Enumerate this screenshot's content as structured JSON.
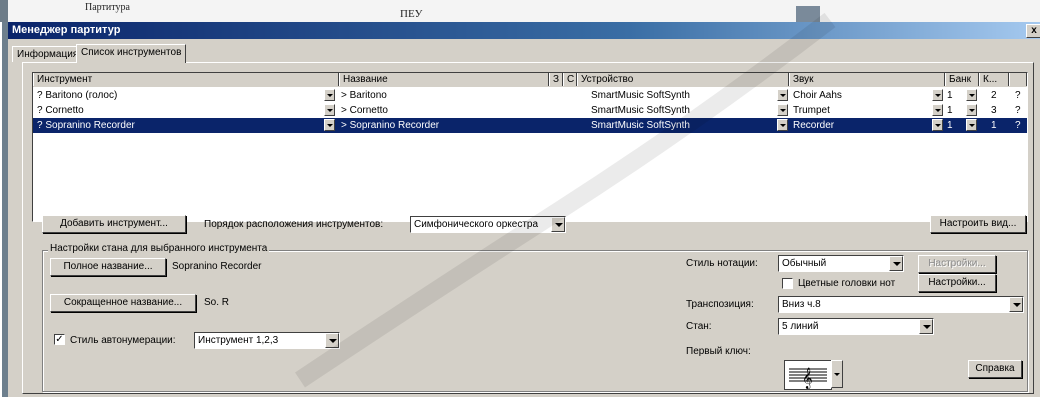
{
  "background": {
    "top_text_1": "Партитура",
    "top_text_2": "ПЕУ"
  },
  "window": {
    "title": "Менеджер партитур",
    "close_label": "x",
    "tabs": [
      {
        "label": "Информация"
      },
      {
        "label": "Список инструментов"
      }
    ]
  },
  "instruments_table": {
    "headers": [
      "Инструмент",
      "Название",
      "З",
      "С",
      "Устройство",
      "Звук",
      "Банк",
      "К..."
    ],
    "rows": [
      {
        "instrument": "? Baritono (голос)",
        "name": "> Baritono",
        "device": "SmartMusic SoftSynth",
        "sound": "Choir Aahs",
        "bank": "1",
        "k": "2",
        "q": "?"
      },
      {
        "instrument": "? Cornetto",
        "name": "> Cornetto",
        "device": "SmartMusic SoftSynth",
        "sound": "Trumpet",
        "bank": "1",
        "k": "3",
        "q": "?"
      },
      {
        "instrument": "? Sopranino Recorder",
        "name": "> Sopranino Recorder",
        "device": "SmartMusic SoftSynth",
        "sound": "Recorder",
        "bank": "1",
        "k": "1",
        "q": "?"
      }
    ]
  },
  "controls": {
    "add_instrument": "Добавить инструмент...",
    "order_label": "Порядок расположения инструментов:",
    "order_value": "Симфонического оркестра",
    "customize_view": "Настроить вид..."
  },
  "staff_settings": {
    "group_title": "Настройки стана для выбранного инструмента",
    "full_name_button": "Полное название...",
    "full_name_value": "Sopranino Recorder",
    "short_name_button": "Сокращенное название...",
    "short_name_value": "So. R",
    "autonumber_checkbox_mark": "✓",
    "autonumber_label": "Стиль автонумерации:",
    "autonumber_value": "Инструмент 1,2,3",
    "notation_style_label": "Стиль нотации:",
    "notation_style_value": "Обычный",
    "notation_settings_button": "Настройки...",
    "color_noteheads_label": "Цветные головки нот",
    "noteheads_settings_button": "Настройки...",
    "transposition_label": "Транспозиция:",
    "transposition_value": "Вниз ч.8",
    "staff_label": "Стан:",
    "staff_value": "5 линий",
    "first_clef_label": "Первый ключ:",
    "help_button": "Справка"
  },
  "colors": {
    "titlebar": "#0a246a",
    "selection": "#0a246a",
    "face": "#d4d0c8"
  }
}
